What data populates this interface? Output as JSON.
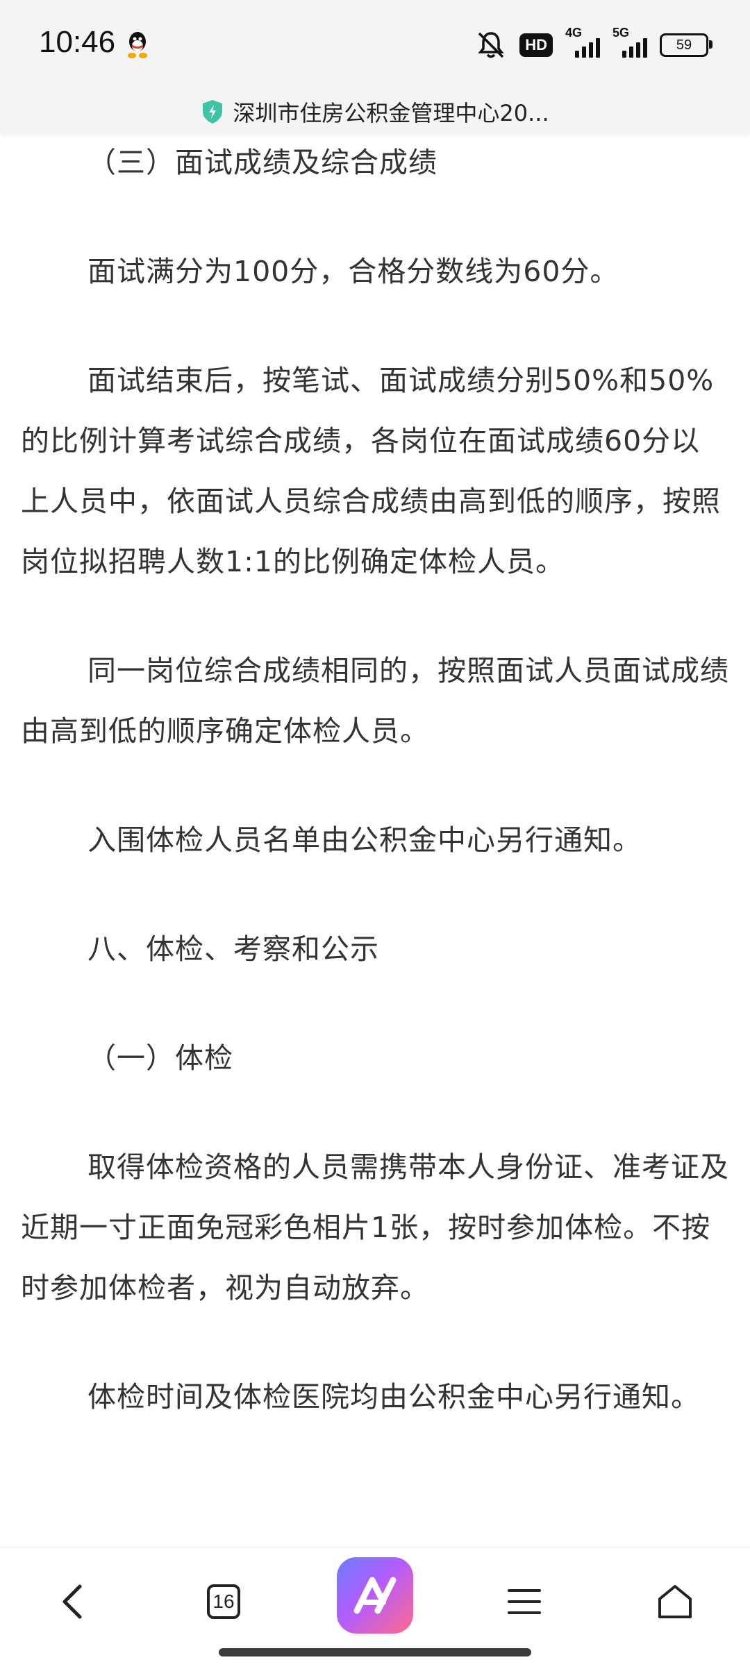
{
  "status_bar": {
    "time": "10:46",
    "hd_label": "HD",
    "net1_label": "4G",
    "net2_label": "5G",
    "battery": "59"
  },
  "title_bar": {
    "title": "深圳市住房公积金管理中心20..."
  },
  "article": {
    "paragraphs": [
      "（三）面试成绩及综合成绩",
      "面试满分为100分，合格分数线为60分。",
      "面试结束后，按笔试、面试成绩分别50%和50%的比例计算考试综合成绩，各岗位在面试成绩60分以上人员中，依面试人员综合成绩由高到低的顺序，按照岗位拟招聘人数1:1的比例确定体检人员。",
      "同一岗位综合成绩相同的，按照面试人员面试成绩由高到低的顺序确定体检人员。",
      "入围体检人员名单由公积金中心另行通知。",
      "八、体检、考察和公示",
      "（一）体检",
      "取得体检资格的人员需携带本人身份证、准考证及近期一寸正面免冠彩色相片1张，按时参加体检。不按时参加体检者，视为自动放弃。",
      "体检时间及体检医院均由公积金中心另行通知。"
    ]
  },
  "bottom_nav": {
    "tab_count": "16",
    "icons": [
      "back-icon",
      "tabs-icon",
      "ai-assistant-icon",
      "menu-icon",
      "home-icon"
    ]
  },
  "colors": {
    "text": "#333333",
    "bar_bg": "#f4f4f4",
    "shield": "#3ec3a5"
  }
}
